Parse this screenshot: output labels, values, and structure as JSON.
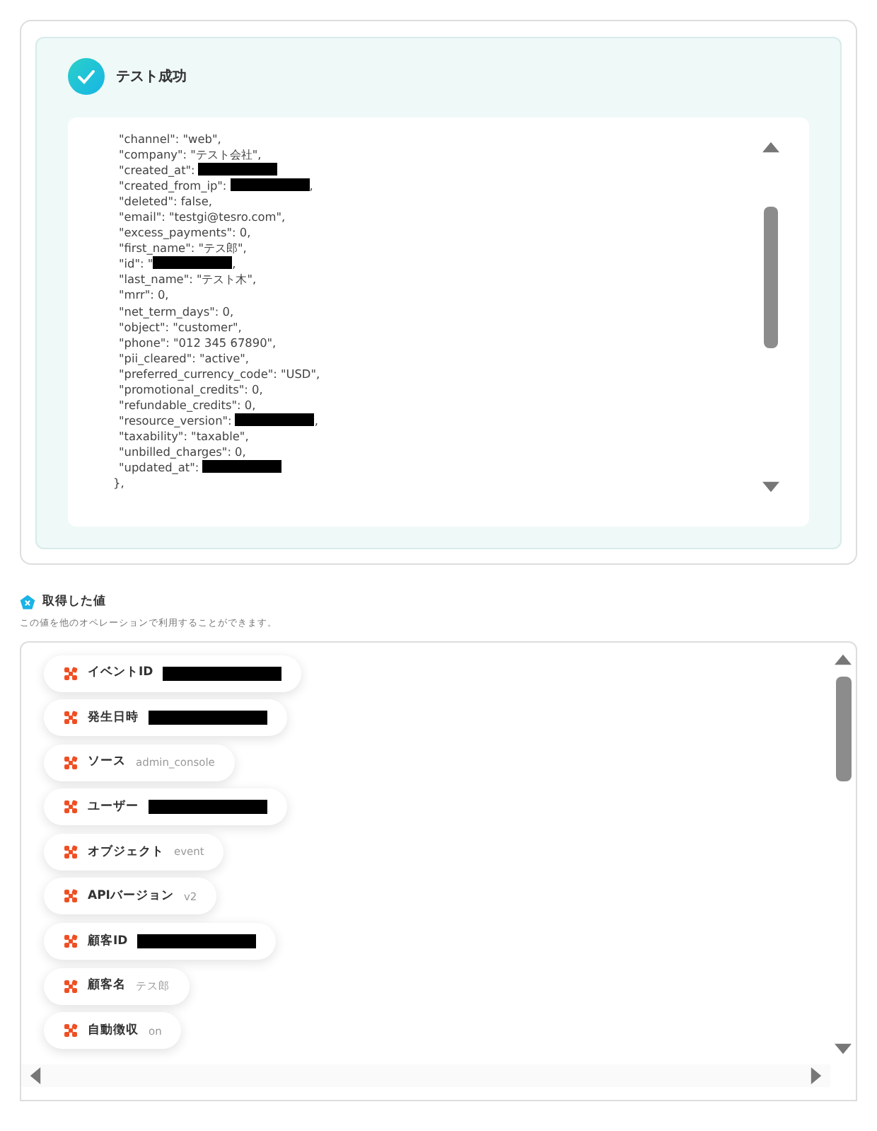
{
  "test_result": {
    "title": "テスト成功",
    "success": true,
    "lines": [
      {
        "text": "\"channel\": \"web\","
      },
      {
        "text": "\"company\": \"テスト会社\","
      },
      {
        "text": "\"created_at\": ",
        "redacted": true
      },
      {
        "text": "\"created_from_ip\": ",
        "redacted": true,
        "suffix": ","
      },
      {
        "text": "\"deleted\": false,"
      },
      {
        "text": "\"email\": \"testgi@tesro.com\","
      },
      {
        "text": "\"excess_payments\": 0,"
      },
      {
        "text": "\"first_name\": \"テス郎\","
      },
      {
        "text": "\"id\": \"",
        "redacted": true,
        "suffix": ","
      },
      {
        "text": "\"last_name\": \"テスト木\","
      },
      {
        "text": "\"mrr\": 0,"
      },
      {
        "text": "\"net_term_days\": 0,"
      },
      {
        "text": "\"object\": \"customer\","
      },
      {
        "text": "\"phone\": \"012 345 67890\","
      },
      {
        "text": "\"pii_cleared\": \"active\","
      },
      {
        "text": "\"preferred_currency_code\": \"USD\","
      },
      {
        "text": "\"promotional_credits\": 0,"
      },
      {
        "text": "\"refundable_credits\": 0,"
      },
      {
        "text": "\"resource_version\": ",
        "redacted": true,
        "suffix": ","
      },
      {
        "text": "\"taxability\": \"taxable\","
      },
      {
        "text": "\"unbilled_charges\": 0,"
      },
      {
        "text": "\"updated_at\": ",
        "redacted": true
      }
    ],
    "closing": "},"
  },
  "values": {
    "title": "取得した値",
    "subtitle": "この値を他のオペレーションで利用することができます。",
    "items": [
      {
        "label": "イベントID",
        "redacted": true
      },
      {
        "label": "発生日時",
        "redacted": true
      },
      {
        "label": "ソース",
        "value": "admin_console"
      },
      {
        "label": "ユーザー",
        "redacted": true
      },
      {
        "label": "オブジェクト",
        "value": "event"
      },
      {
        "label": "APIバージョン",
        "value": "v2"
      },
      {
        "label": "顧客ID",
        "redacted": true
      },
      {
        "label": "顧客名",
        "value": "テス郎"
      },
      {
        "label": "自動徴収",
        "value": "on"
      }
    ]
  }
}
